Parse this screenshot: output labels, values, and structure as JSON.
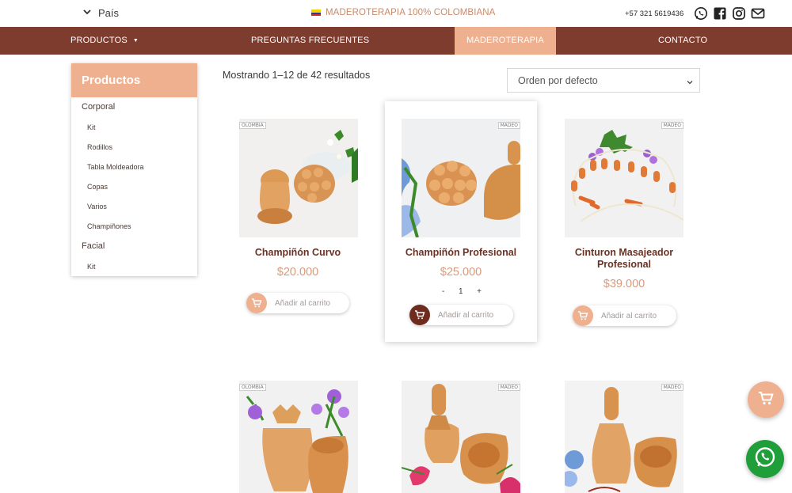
{
  "topbar": {
    "country_label": "País",
    "promo_text": "MADEROTERAPIA 100% COLOMBIANA",
    "phone": "+57 321 5619436",
    "social_icons": [
      "whatsapp-icon",
      "facebook-icon",
      "instagram-icon",
      "email-icon"
    ]
  },
  "nav": {
    "items": [
      {
        "label": "PRODUCTOS"
      },
      {
        "label": "PREGUNTAS FRECUENTES"
      },
      {
        "label": "MADEROTERAPIA"
      },
      {
        "label": "CONTACTO"
      }
    ],
    "active": "MADEROTERAPIA"
  },
  "sidebar": {
    "title": "Productos",
    "categories": [
      {
        "label": "Corporal",
        "children": [
          "Kit",
          "Rodillos",
          "Tabla Moldeadora",
          "Copas",
          "Varios",
          "Champiñones"
        ]
      },
      {
        "label": "Facial",
        "children": [
          "Kit"
        ]
      }
    ]
  },
  "main": {
    "results_text": "Mostrando 1–12 de 42 resultados",
    "orderby_selected": "Orden por defecto"
  },
  "products": [
    {
      "title": "Champiñón Curvo",
      "price": "$20.000",
      "button": "Añadir al carrito",
      "brand_tag": "OLOMBIA"
    },
    {
      "title": "Champiñón Profesional",
      "price": "$25.000",
      "button": "Añadir al carrito",
      "qty_minus": "-",
      "qty_value": "1",
      "qty_plus": "+",
      "brand_tag": "MADEO"
    },
    {
      "title": "Cinturon Masajeador Profesional",
      "price": "$39.000",
      "button": "Añadir al carrito",
      "brand_tag": "MADEO"
    },
    {
      "brand_tag": "OLOMBIA"
    },
    {
      "brand_tag": "MADEO"
    },
    {
      "brand_tag": "MADEO"
    }
  ],
  "colors": {
    "nav_bg": "#7e3c2e",
    "accent": "#efb08f",
    "title_color": "#6a3224",
    "price_color": "#d89a7a",
    "whatsapp_green": "#1f9e3a"
  }
}
